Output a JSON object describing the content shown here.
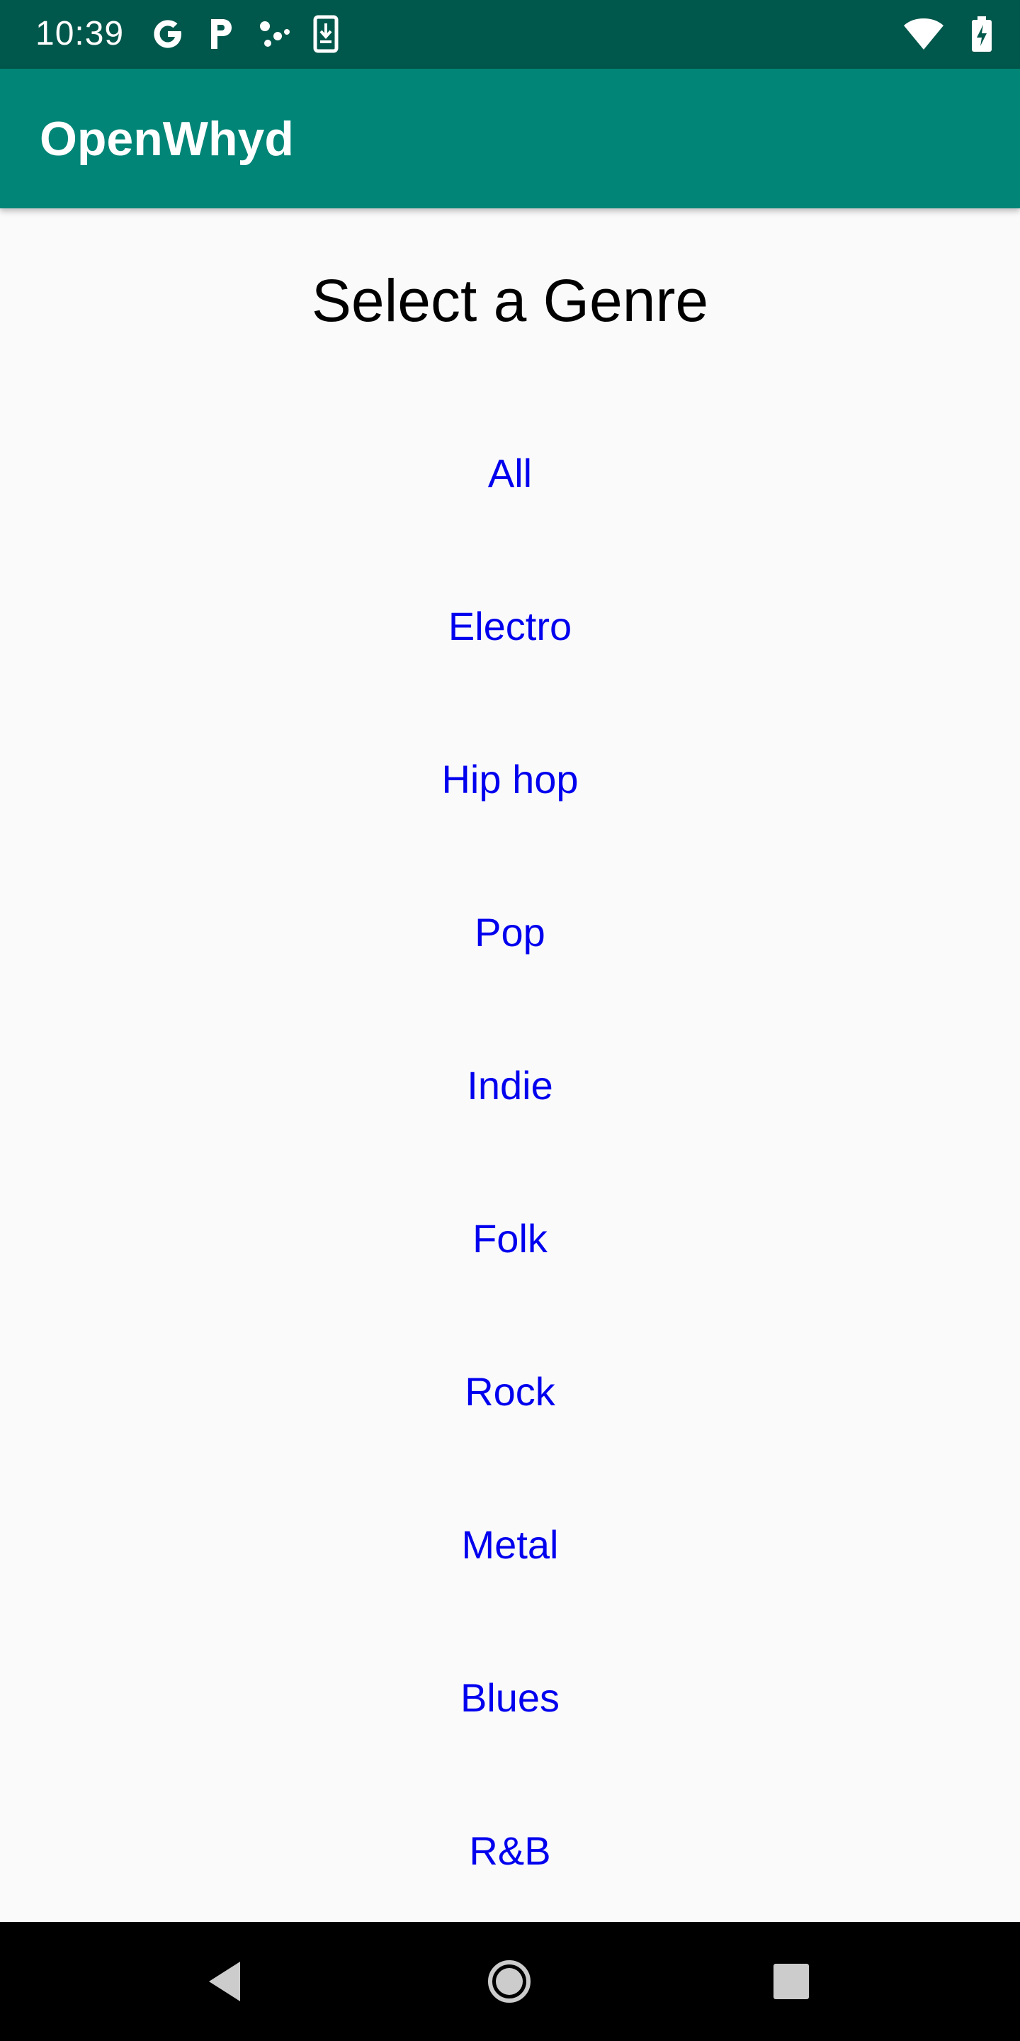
{
  "status_bar": {
    "time": "10:39",
    "left_icons": [
      "google-icon",
      "parking-icon",
      "assistant-dots-icon",
      "download-icon"
    ],
    "right_icons": [
      "wifi-icon",
      "battery-charging-icon"
    ]
  },
  "app_bar": {
    "title": "OpenWhyd"
  },
  "main": {
    "heading": "Select a Genre",
    "genres": [
      "All",
      "Electro",
      "Hip hop",
      "Pop",
      "Indie",
      "Folk",
      "Rock",
      "Metal",
      "Blues",
      "R&B"
    ]
  },
  "nav_bar": {
    "buttons": [
      "back-icon",
      "home-icon",
      "recents-icon"
    ]
  },
  "colors": {
    "status_bar": "#00574b",
    "app_bar": "#008577",
    "background": "#fafafa",
    "link": "#0000ee",
    "nav_bar": "#000000"
  }
}
